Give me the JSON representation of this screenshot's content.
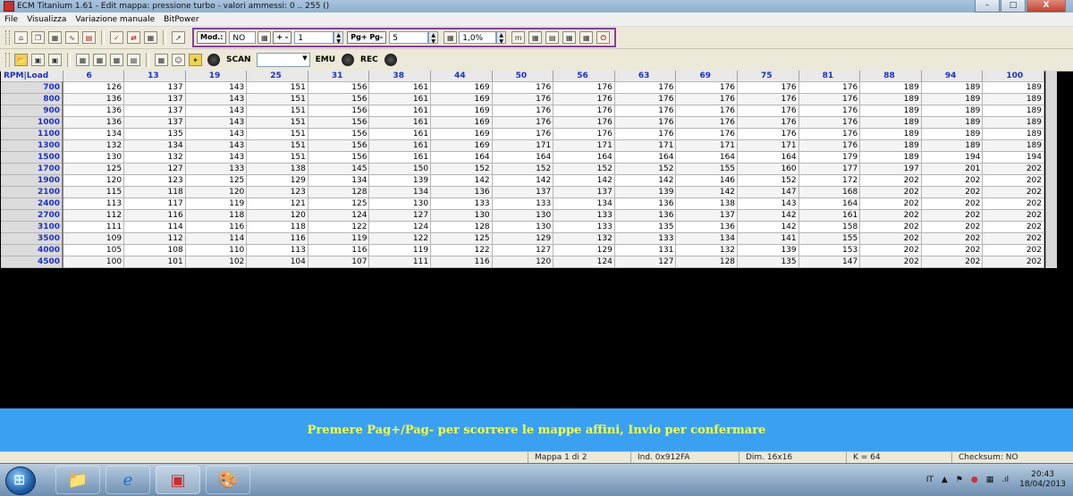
{
  "window": {
    "title": "ECM Titanium 1.61 - Edit mappa: pressione turbo - valori ammessi: 0 .. 255 ()",
    "min_label": "–",
    "max_label": "□",
    "close_label": "X"
  },
  "menu": [
    "File",
    "Visualizza",
    "Variazione manuale",
    "BitPower"
  ],
  "toolbar1": {
    "mod_label": "Mod.:",
    "mod_value": "NO",
    "plusminus_label": "+ -",
    "plusminus_value": "1",
    "page_label": "Pg+ Pg-",
    "page_value": "5",
    "percent_value": "1,0%"
  },
  "toolbar2": {
    "scan_label": "SCAN",
    "emu_label": "EMU",
    "rec_label": "REC"
  },
  "grid": {
    "corner": "RPM|Load",
    "load": [
      "6",
      "13",
      "19",
      "25",
      "31",
      "38",
      "44",
      "50",
      "56",
      "63",
      "69",
      "75",
      "81",
      "88",
      "94",
      "100"
    ],
    "rpm": [
      "700",
      "800",
      "900",
      "1000",
      "1100",
      "1300",
      "1500",
      "1700",
      "1900",
      "2100",
      "2400",
      "2700",
      "3100",
      "3500",
      "4000",
      "4500"
    ],
    "values": [
      [
        126,
        137,
        143,
        151,
        156,
        161,
        169,
        176,
        176,
        176,
        176,
        176,
        176,
        189,
        189,
        189
      ],
      [
        136,
        137,
        143,
        151,
        156,
        161,
        169,
        176,
        176,
        176,
        176,
        176,
        176,
        189,
        189,
        189
      ],
      [
        136,
        137,
        143,
        151,
        156,
        161,
        169,
        176,
        176,
        176,
        176,
        176,
        176,
        189,
        189,
        189
      ],
      [
        136,
        137,
        143,
        151,
        156,
        161,
        169,
        176,
        176,
        176,
        176,
        176,
        176,
        189,
        189,
        189
      ],
      [
        134,
        135,
        143,
        151,
        156,
        161,
        169,
        176,
        176,
        176,
        176,
        176,
        176,
        189,
        189,
        189
      ],
      [
        132,
        134,
        143,
        151,
        156,
        161,
        169,
        171,
        171,
        171,
        171,
        171,
        176,
        189,
        189,
        189
      ],
      [
        130,
        132,
        143,
        151,
        156,
        161,
        164,
        164,
        164,
        164,
        164,
        164,
        179,
        189,
        194,
        194
      ],
      [
        125,
        127,
        133,
        138,
        145,
        150,
        152,
        152,
        152,
        152,
        155,
        160,
        177,
        197,
        201,
        202
      ],
      [
        120,
        123,
        125,
        129,
        134,
        139,
        142,
        142,
        142,
        142,
        146,
        152,
        172,
        202,
        202,
        202
      ],
      [
        115,
        118,
        120,
        123,
        128,
        134,
        136,
        137,
        137,
        139,
        142,
        147,
        168,
        202,
        202,
        202
      ],
      [
        113,
        117,
        119,
        121,
        125,
        130,
        133,
        133,
        134,
        136,
        138,
        143,
        164,
        202,
        202,
        202
      ],
      [
        112,
        116,
        118,
        120,
        124,
        127,
        130,
        130,
        133,
        136,
        137,
        142,
        161,
        202,
        202,
        202
      ],
      [
        111,
        114,
        116,
        118,
        122,
        124,
        128,
        130,
        133,
        135,
        136,
        142,
        158,
        202,
        202,
        202
      ],
      [
        109,
        112,
        114,
        116,
        119,
        122,
        125,
        129,
        132,
        133,
        134,
        141,
        155,
        202,
        202,
        202
      ],
      [
        105,
        108,
        110,
        113,
        116,
        119,
        122,
        127,
        129,
        131,
        132,
        139,
        153,
        202,
        202,
        202
      ],
      [
        100,
        101,
        102,
        104,
        107,
        111,
        116,
        120,
        124,
        127,
        128,
        135,
        147,
        202,
        202,
        202
      ]
    ]
  },
  "hint": "Premere Pag+/Pag- per scorrere le mappe affini, Invio per confermare",
  "status": {
    "mappa": "Mappa 1 di 2",
    "ind": "Ind. 0x912FA",
    "dim": "Dim. 16x16",
    "k": "K = 64",
    "checksum": "Checksum: NO"
  },
  "taskbar": {
    "lang": "IT",
    "time": "20:43",
    "date": "18/04/2013"
  },
  "colors": {
    "header_text": "#1a2fcc",
    "hint_bg": "#3aa1f2",
    "hint_text": "#ffff33"
  }
}
